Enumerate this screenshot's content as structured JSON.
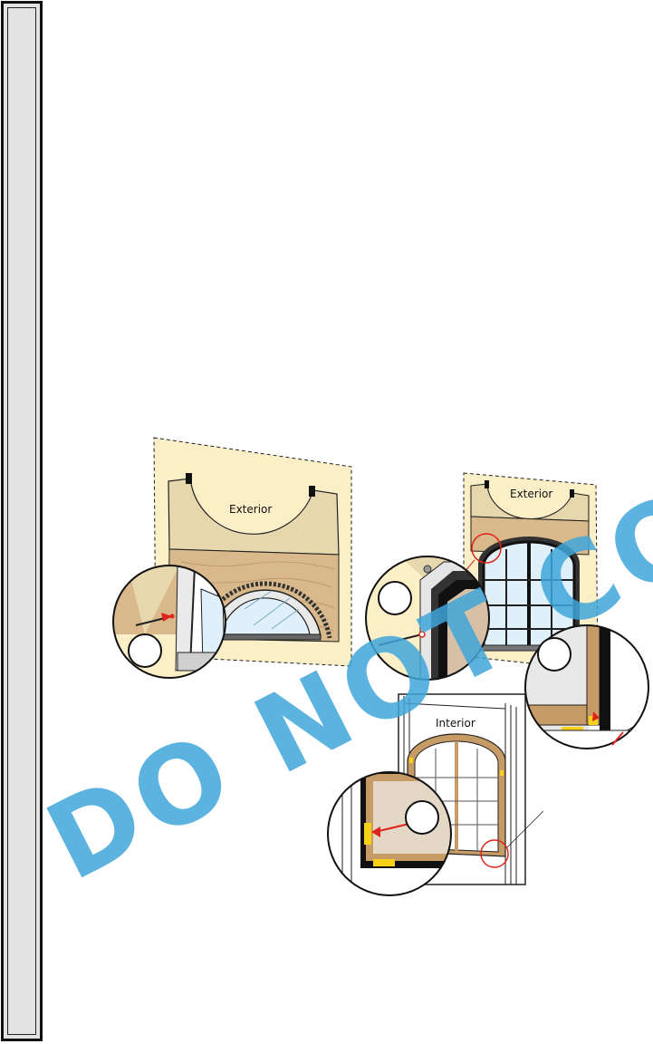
{
  "watermark": {
    "text": "DO NOT COPY",
    "color": "#3fa6d9"
  },
  "figures": {
    "exterior_half_round": {
      "label": "Exterior",
      "callout": ""
    },
    "exterior_arched": {
      "label": "Exterior",
      "callout": ""
    },
    "interior": {
      "label": "Interior",
      "callout_left": "",
      "callout_right": ""
    }
  },
  "colors": {
    "wall_panel": "#fbefc8",
    "lumber": "#d9b98c",
    "header_trim": "#e6d7ad",
    "frame_brown": "#c79b66",
    "glass": "#dff0fa",
    "shim_yellow": "#f7d116",
    "nail_red": "#e0241b"
  }
}
